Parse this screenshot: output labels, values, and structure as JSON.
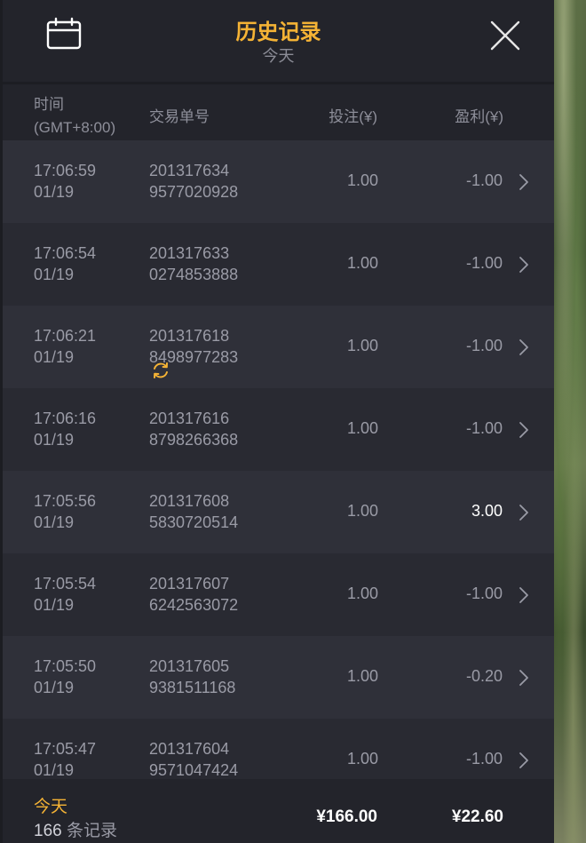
{
  "header": {
    "title": "历史记录",
    "subtitle": "今天",
    "calendar_icon": "calendar-icon",
    "close_icon": "close-icon"
  },
  "columns": {
    "time_line1": "时间",
    "time_line2": "(GMT+8:00)",
    "order": "交易单号",
    "bet": "投注(¥)",
    "profit": "盈利(¥)"
  },
  "rows": [
    {
      "time": "17:06:59",
      "date": "01/19",
      "order1": "201317634",
      "order2": "9577020928",
      "bet": "1.00",
      "profit": "-1.00",
      "pending": false
    },
    {
      "time": "17:06:54",
      "date": "01/19",
      "order1": "201317633",
      "order2": "0274853888",
      "bet": "1.00",
      "profit": "-1.00",
      "pending": false
    },
    {
      "time": "17:06:21",
      "date": "01/19",
      "order1": "201317618",
      "order2": "8498977283",
      "bet": "1.00",
      "profit": "-1.00",
      "pending": true
    },
    {
      "time": "17:06:16",
      "date": "01/19",
      "order1": "201317616",
      "order2": "8798266368",
      "bet": "1.00",
      "profit": "-1.00",
      "pending": false
    },
    {
      "time": "17:05:56",
      "date": "01/19",
      "order1": "201317608",
      "order2": "5830720514",
      "bet": "1.00",
      "profit": "3.00",
      "pending": false
    },
    {
      "time": "17:05:54",
      "date": "01/19",
      "order1": "201317607",
      "order2": "6242563072",
      "bet": "1.00",
      "profit": "-1.00",
      "pending": false
    },
    {
      "time": "17:05:50",
      "date": "01/19",
      "order1": "201317605",
      "order2": "9381511168",
      "bet": "1.00",
      "profit": "-0.20",
      "pending": false
    },
    {
      "time": "17:05:47",
      "date": "01/19",
      "order1": "201317604",
      "order2": "9571047424",
      "bet": "1.00",
      "profit": "-1.00",
      "pending": false
    }
  ],
  "footer": {
    "period": "今天",
    "count": "166",
    "count_suffix": " 条记录",
    "total_bet": "¥166.00",
    "total_profit": "¥22.60"
  },
  "colors": {
    "accent": "#f5b335",
    "panel": "#2a2b33",
    "header": "#23242b"
  }
}
